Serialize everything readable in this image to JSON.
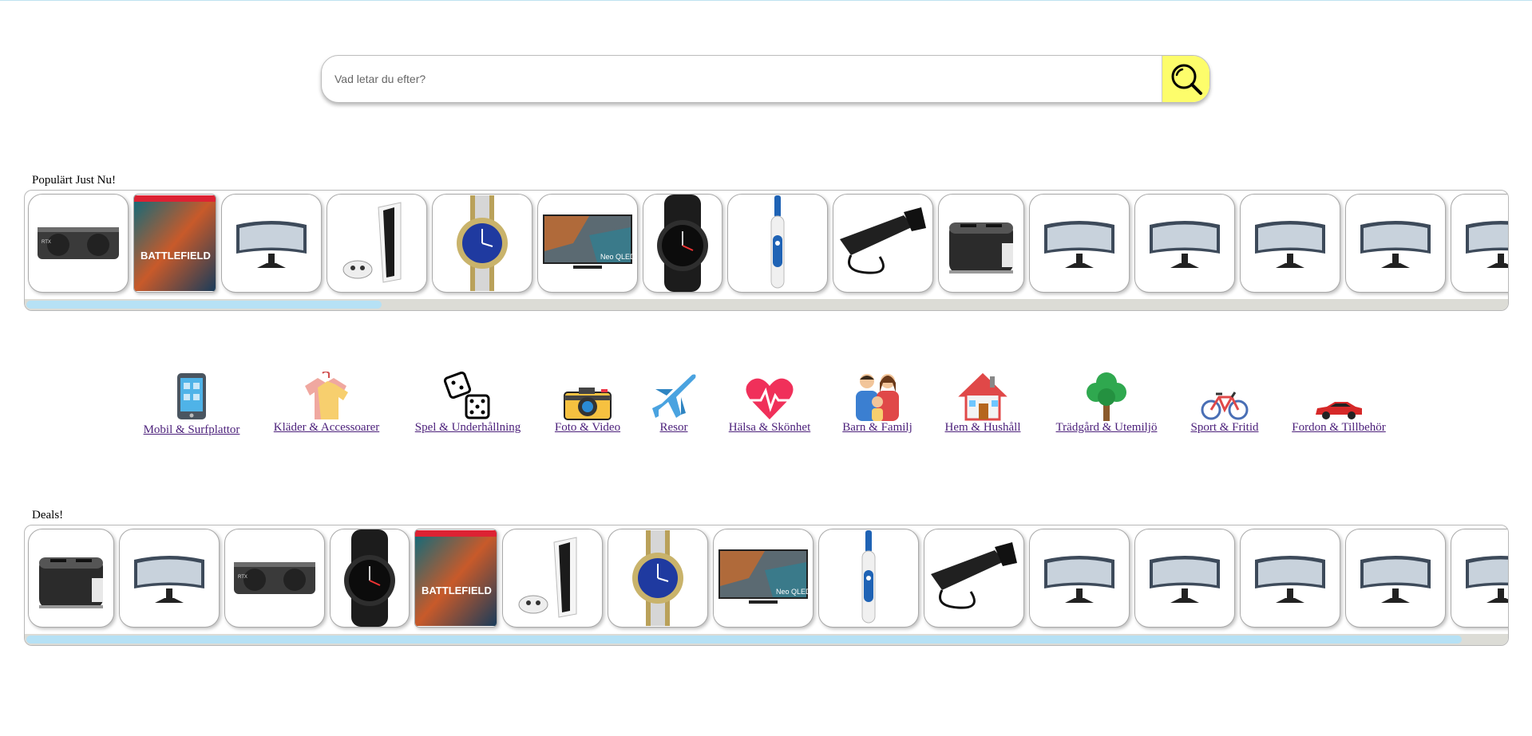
{
  "search": {
    "placeholder": "Vad letar du efter?",
    "icon": "search-icon"
  },
  "popular": {
    "title": "Populärt Just Nu!",
    "items": [
      "graphics-card",
      "battlefield-game",
      "curved-monitor",
      "ps5-console",
      "wristwatch",
      "neo-qled-tv",
      "smartwatch",
      "electric-toothbrush",
      "flashlight",
      "toaster",
      "curved-monitor",
      "curved-monitor",
      "curved-monitor",
      "curved-monitor",
      "curved-monitor"
    ],
    "scroll_position": 0.24
  },
  "categories": [
    {
      "label": "Mobil & Surfplattor",
      "icon": "mobile-icon"
    },
    {
      "label": "Kläder & Accessoarer",
      "icon": "clothes-icon"
    },
    {
      "label": "Spel & Underhållning",
      "icon": "dice-icon"
    },
    {
      "label": "Foto & Video",
      "icon": "camera-icon"
    },
    {
      "label": "Resor",
      "icon": "airplane-icon"
    },
    {
      "label": "Hälsa & Skönhet",
      "icon": "heart-icon"
    },
    {
      "label": "Barn & Familj",
      "icon": "family-icon"
    },
    {
      "label": "Hem & Hushåll",
      "icon": "house-icon"
    },
    {
      "label": "Trädgård & Utemiljö",
      "icon": "tree-icon"
    },
    {
      "label": "Sport & Fritid",
      "icon": "bicycle-icon"
    },
    {
      "label": "Fordon & Tillbehör",
      "icon": "car-icon"
    }
  ],
  "deals": {
    "title": "Deals!",
    "items": [
      "toaster",
      "curved-monitor",
      "graphics-card",
      "smartwatch",
      "battlefield-game",
      "ps5-console",
      "wristwatch",
      "neo-qled-tv",
      "electric-toothbrush",
      "flashlight",
      "curved-monitor",
      "curved-monitor",
      "curved-monitor",
      "curved-monitor",
      "curved-monitor"
    ],
    "scroll_position": 0.97
  },
  "colors": {
    "search_button": "#fdfd6b",
    "scroll_thumb": "#b6e1f5",
    "link": "#4b1f7a"
  }
}
